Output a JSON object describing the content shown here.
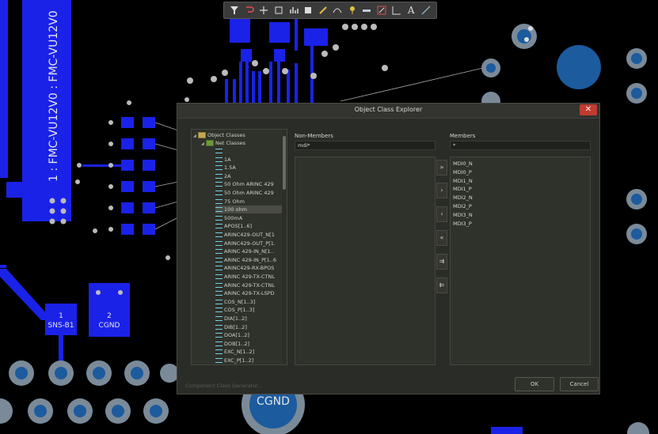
{
  "pcb": {
    "label_net_fmc": "1 : FMC-VU12V0 : FMC-VU12V0",
    "pad_sns_number": "1",
    "pad_sns_name": "SNS-B1",
    "pad_cgnd_number": "2",
    "pad_cgnd_name": "CGND",
    "bottom_pad_label": "CGND"
  },
  "toolbar": {
    "tools": [
      "filter-icon",
      "route-icon",
      "cross-icon",
      "rect-icon",
      "bar-chart-icon",
      "component-icon",
      "pencil-icon",
      "arc-icon",
      "pin-icon",
      "layer-icon",
      "rect-select-icon",
      "dimension-icon",
      "text-icon",
      "line-icon"
    ],
    "text_tool_glyph": "A"
  },
  "dialog": {
    "title": "Object Class Explorer",
    "close_glyph": "✕",
    "tree": {
      "root": "Object Classes",
      "group": "Net Classes",
      "items": [
        "",
        "1A",
        "1.5A",
        "2A",
        "50 Ohm ARINC 429",
        "50 Ohm ARINC 429",
        "75 Ohm",
        "100 ohm",
        "500mA",
        "APOS[1..6]",
        "ARINC429-OUT_N[1",
        "ARINC429-OUT_P[1.",
        "ARINC 429-IN_N[1..",
        "ARINC 429-IN_P[1..6",
        "ARINC429-RX-BPOS",
        "ARINC 429-TX-CTNL",
        "ARINC 429-TX-CTNL",
        "ARINC 429-TX-LSPD",
        "COS_N[1..3]",
        "COS_P[1..3]",
        "DIA[1..2]",
        "DIB[1..2]",
        "DOA[1..2]",
        "DOB[1..2]",
        "EXC_N[1..2]",
        "EXC_P[1..2]"
      ],
      "selected_index": 7
    },
    "nonmembers": {
      "label": "Non-Members",
      "filter_value": "mdi*"
    },
    "members": {
      "label": "Members",
      "filter_value": "*",
      "items": [
        "MDI0_N",
        "MDI0_P",
        "MDI1_N",
        "MDI1_P",
        "MDI2_N",
        "MDI2_P",
        "MDI3_N",
        "MDI3_P"
      ]
    },
    "move_buttons": [
      "»",
      "›",
      "‹",
      "«",
      "⇉",
      "⇇"
    ],
    "generator_link": "Component Class Generator...",
    "ok_label": "OK",
    "cancel_label": "Cancel"
  }
}
